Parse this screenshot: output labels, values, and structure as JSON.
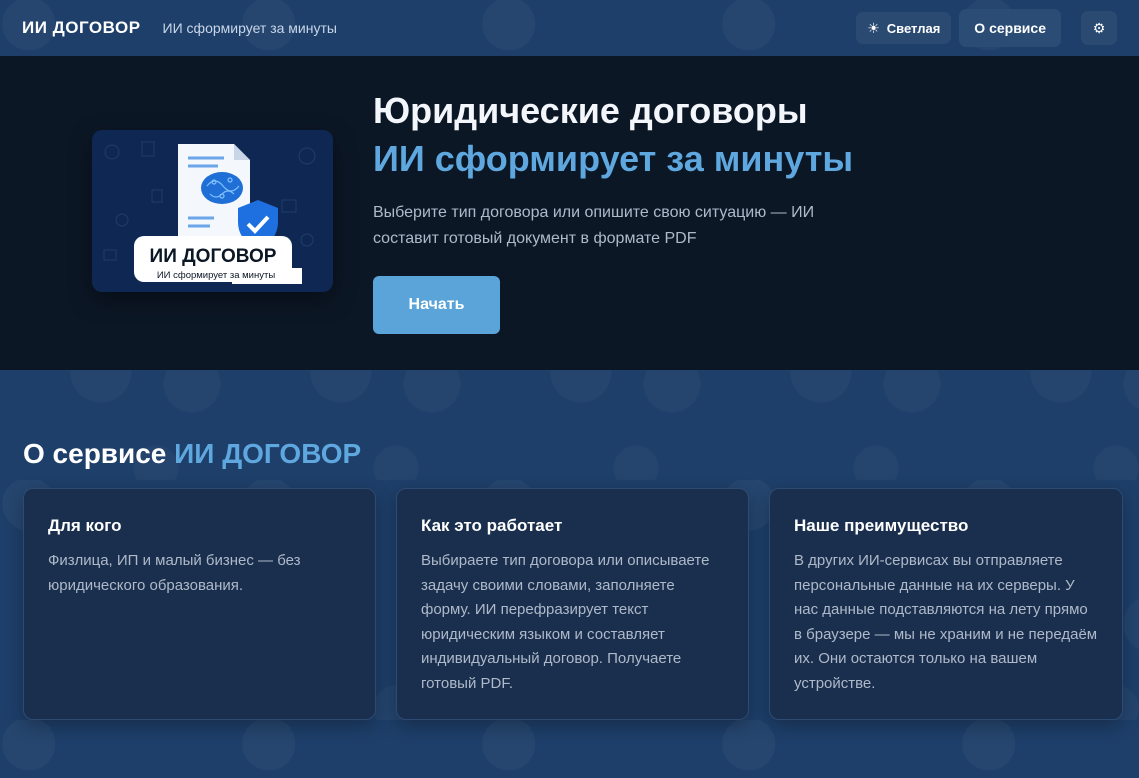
{
  "header": {
    "brand": "ИИ ДОГОВОР",
    "tagline": "ИИ сформирует за минуты",
    "theme_label": "Светлая",
    "theme_icon": "sun-icon",
    "about_label": "О сервисе",
    "settings_icon": "gear-icon"
  },
  "hero": {
    "title": "Юридические договоры",
    "subtitle": "ИИ сформирует за минуты",
    "description": "Выберите тип договора или опишите свою ситуацию — ИИ составит готовый документ в формате PDF",
    "start_label": "Начать",
    "logo_title": "ИИ ДОГОВОР",
    "logo_subtitle": "ИИ сформирует за минуты"
  },
  "about": {
    "heading": "О сервисе",
    "heading_accent": "ИИ ДОГОВОР",
    "cards": [
      {
        "title": "Для кого",
        "text": "Физлица, ИП и малый бизнес — без юридического образования."
      },
      {
        "title": "Как это работает",
        "text": "Выбираете тип договора или описываете задачу своими словами, заполняете форму. ИИ перефразирует текст юридическим языком и составляет индивидуальный договор. Получаете готовый PDF."
      },
      {
        "title": "Наше преимущество",
        "text": "В других ИИ-сервисах вы отправляете персональные данные на их серверы. У нас данные подставляются на лету прямо в браузере — мы не храним и не передаём их. Они остаются только на вашем устройстве."
      }
    ]
  },
  "colors": {
    "background": "#1e3f6a",
    "hero_background": "#0c1726",
    "accent": "#5fa8df",
    "button": "#5ba4da",
    "card": "#1a2f4e"
  }
}
